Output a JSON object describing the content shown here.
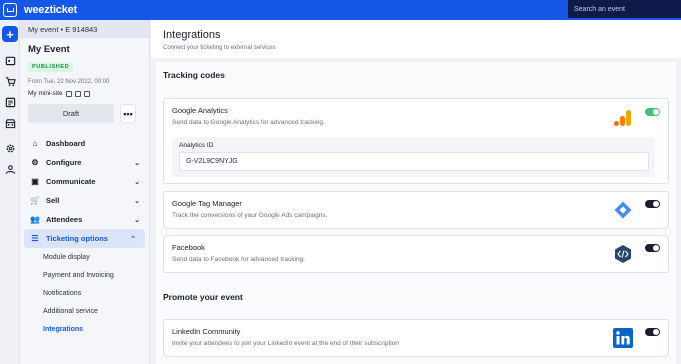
{
  "app": {
    "name": "weezticket",
    "search_placeholder": "Search an event"
  },
  "event": {
    "header": "My event • E 914843",
    "title": "My Event",
    "status": "PUBLISHED",
    "date": "From Tue, 22 Nov 2022, 00:00",
    "mini_site": "My mini-site",
    "draft_label": "Draft",
    "more_label": "•••"
  },
  "nav": {
    "dashboard": "Dashboard",
    "configure": "Configure",
    "communicate": "Communicate",
    "sell": "Sell",
    "attendees": "Attendees",
    "ticketing_options": "Ticketing options",
    "sub": {
      "module_display": "Module display",
      "payment": "Payment and Invoicing",
      "notifications": "Notifications",
      "additional": "Additional service",
      "integrations": "Integrations"
    }
  },
  "page": {
    "title": "Integrations",
    "subtitle": "Connect your ticketing to external services"
  },
  "sections": {
    "tracking": {
      "title": "Tracking codes",
      "google_analytics": {
        "name": "Google Analytics",
        "desc": "Send data to Google Analytics for advanced tracking.",
        "field_label": "Analytics ID",
        "field_value": "G-V2L9C9NYJG",
        "enabled": true
      },
      "gtm": {
        "name": "Google Tag Manager",
        "desc": "Track the conversions of your Google Ads campaigns.",
        "enabled": false
      },
      "facebook": {
        "name": "Facebook",
        "desc": "Send data to Facebook for advanced tracking.",
        "enabled": false
      }
    },
    "promote": {
      "title": "Promote your event",
      "linkedin": {
        "name": "LinkedIn Community",
        "desc": "Invite your attendees to join your LinkedIn event at the end of their subscription",
        "enabled": false
      }
    }
  },
  "colors": {
    "primary": "#1558e8",
    "search_bg": "#0d1a4a",
    "toggle_on": "#45c07a",
    "published_bg": "#d9f6e3",
    "published_text": "#1f8a4b"
  }
}
